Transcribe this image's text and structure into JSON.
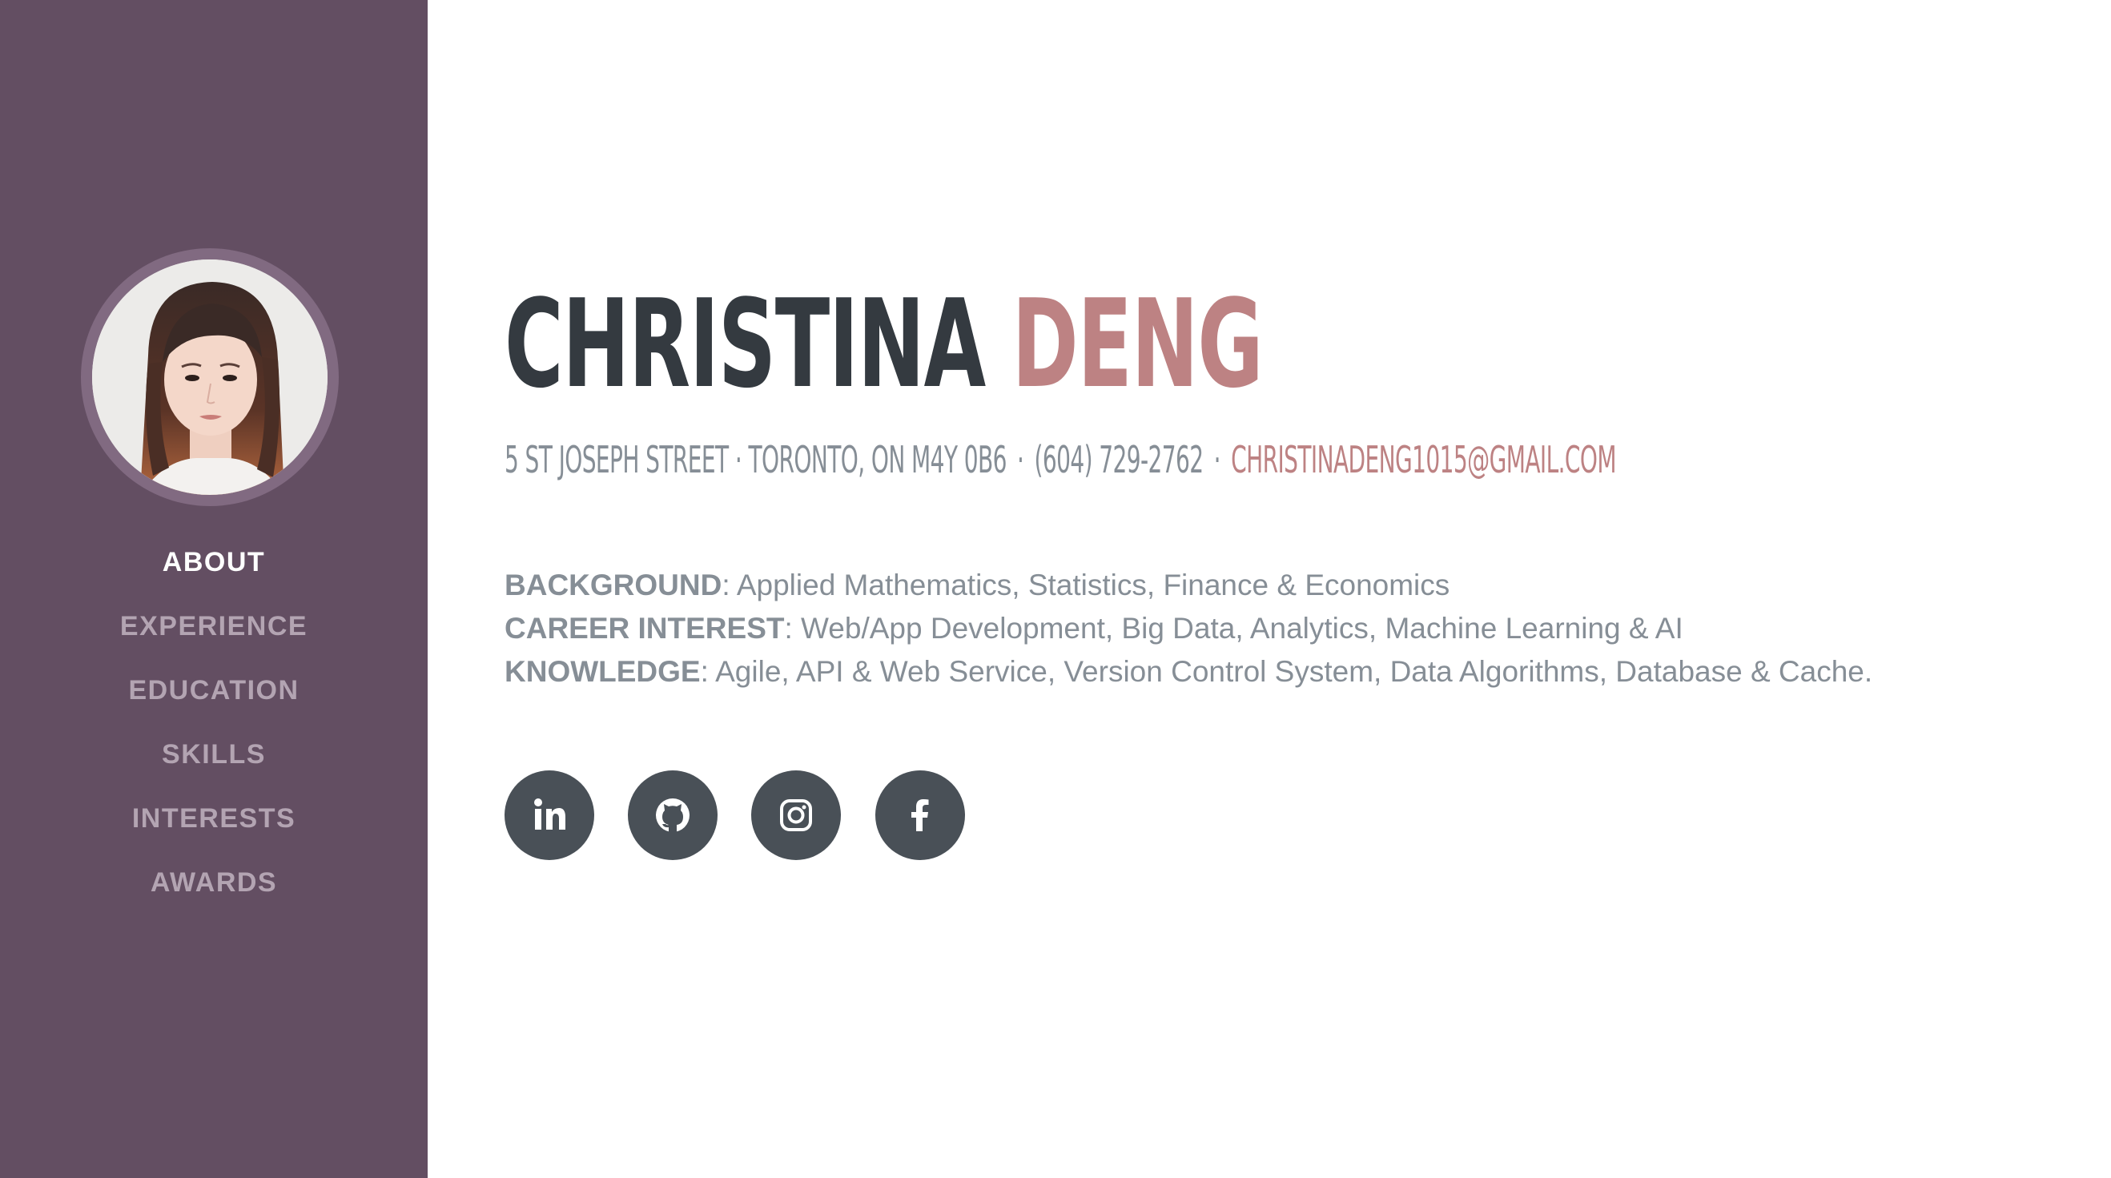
{
  "colors": {
    "sidebar_bg": "#634e62",
    "accent": "#bd8283",
    "heading": "#343a40",
    "body_text": "#868e96",
    "social_bg": "#495057",
    "nav_active": "#ffffff",
    "nav_inactive": "#b3a4b2"
  },
  "sidebar": {
    "nav": [
      {
        "label": "ABOUT",
        "active": true
      },
      {
        "label": "EXPERIENCE",
        "active": false
      },
      {
        "label": "EDUCATION",
        "active": false
      },
      {
        "label": "SKILLS",
        "active": false
      },
      {
        "label": "INTERESTS",
        "active": false
      },
      {
        "label": "AWARDS",
        "active": false
      }
    ]
  },
  "profile": {
    "first_name": "CHRISTINA",
    "last_name": "DENG",
    "address": "5 ST JOSEPH STREET · TORONTO, ON M4Y 0B6",
    "phone": "(604) 729-2762",
    "separator": "·",
    "email": "CHRISTINADENG1015@GMAIL.COM"
  },
  "about": {
    "background_key": "BACKGROUND",
    "background_value": ": Applied Mathematics, Statistics, Finance & Economics",
    "career_key": "CAREER INTEREST",
    "career_value": ": Web/App Development, Big Data, Analytics, Machine Learning & AI",
    "knowledge_key": "KNOWLEDGE",
    "knowledge_value": ": Agile, API & Web Service, Version Control System, Data Algorithms, Database & Cache."
  },
  "social_icons": [
    "linkedin-icon",
    "github-icon",
    "instagram-icon",
    "facebook-icon"
  ]
}
